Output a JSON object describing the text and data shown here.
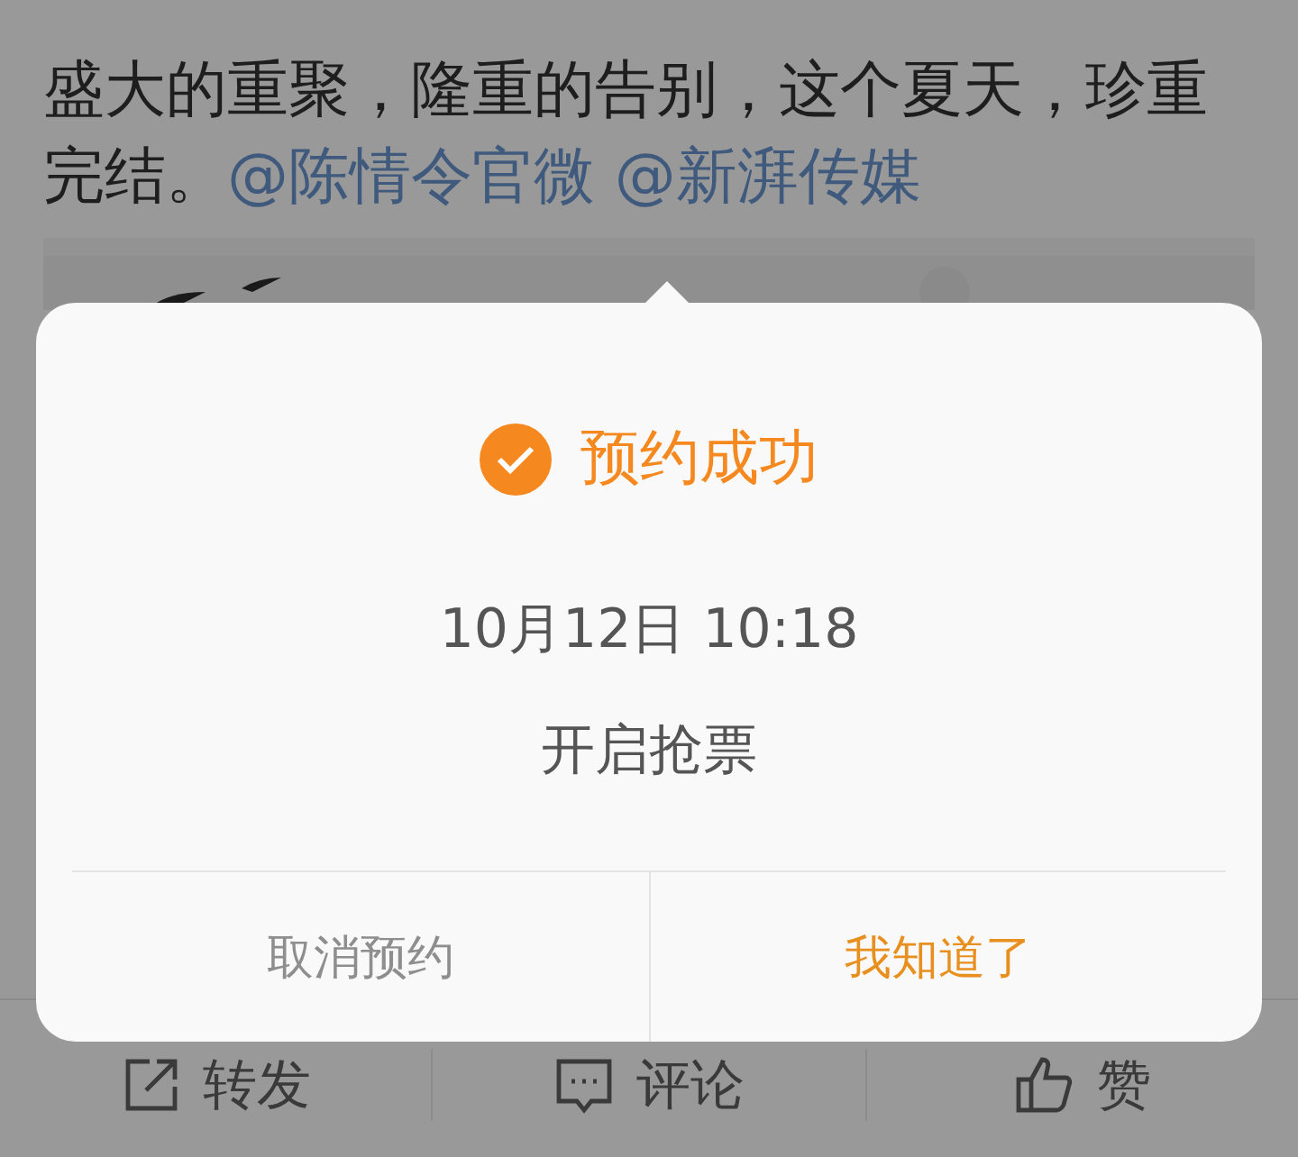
{
  "post": {
    "text": "盛大的重聚，隆重的告别，这个夏天，珍重完结。",
    "mentions": [
      "@陈情令官微",
      "@新湃传媒"
    ]
  },
  "dialog": {
    "title": "预约成功",
    "date": "10月12日 10:18",
    "subtitle": "开启抢票",
    "buttons": [
      {
        "label": "取消预约",
        "kind": "secondary"
      },
      {
        "label": "我知道了",
        "kind": "primary"
      }
    ]
  },
  "actions": [
    {
      "label": "转发",
      "kind": "share"
    },
    {
      "label": "评论",
      "kind": "comment"
    },
    {
      "label": "赞",
      "kind": "like"
    }
  ]
}
